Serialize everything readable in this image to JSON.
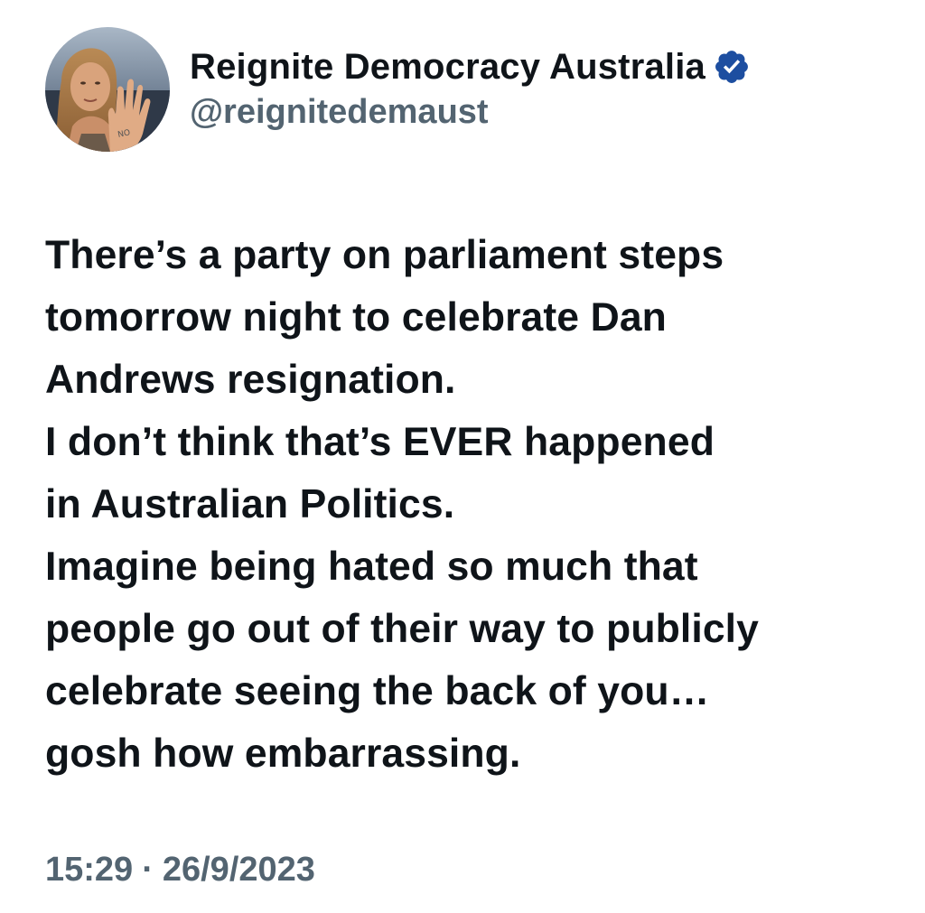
{
  "account": {
    "display_name": "Reignite Democracy Australia",
    "handle": "@reignitedemaust",
    "verified": true,
    "avatar_hand_text": "NO",
    "verified_color": "#1d4ea0"
  },
  "tweet": {
    "lines": [
      "There’s a party on parliament steps",
      "tomorrow night to celebrate Dan",
      "Andrews resignation.",
      "I don’t think that’s EVER happened",
      "in Australian Politics.",
      "Imagine being hated so much that",
      "people go out of their way to publicly",
      "celebrate seeing the back of you…",
      "gosh how embarrassing."
    ],
    "time": "15:29",
    "separator": "·",
    "date": "26/9/2023"
  },
  "icons": {
    "avatar": "profile-photo",
    "verified": "verified-badge-icon"
  },
  "colors": {
    "text": "#0f1419",
    "secondary": "#536471"
  }
}
